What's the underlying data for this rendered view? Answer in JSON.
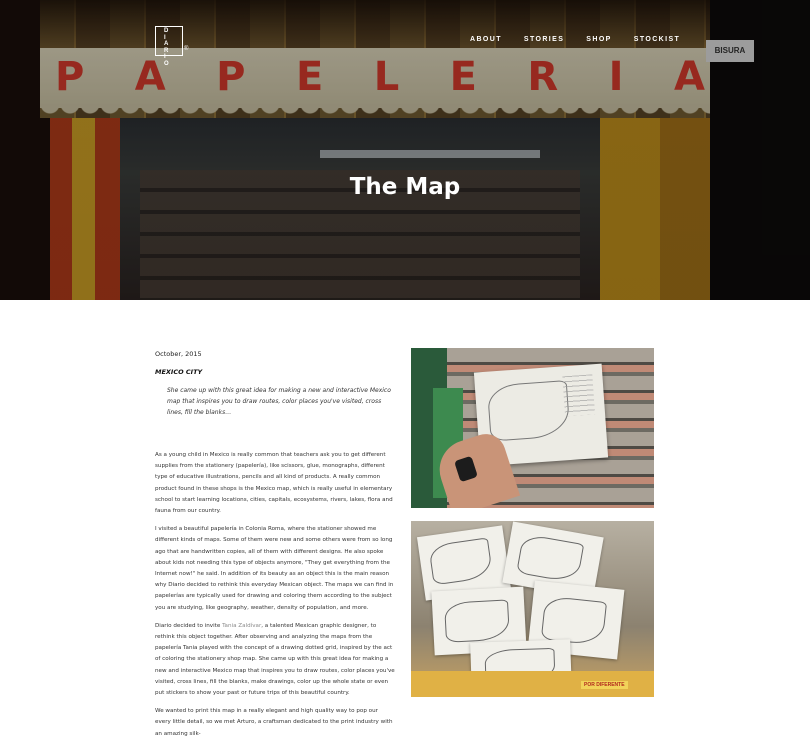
{
  "header": {
    "logo_letters": "D\nI\nA\nR\nI\nO",
    "logo_reg": "®",
    "nav": [
      "ABOUT",
      "STORIES",
      "SHOP",
      "STOCKIST"
    ],
    "hero_title": "The Map",
    "hero_sign": "PAPELERIA"
  },
  "article": {
    "date": "October, 2015",
    "location": "MEXICO CITY",
    "quote": "She came up with this great idea for making a new and interactive Mexico map that inspires you to draw routes, color places you've visited, cross lines, fill the blanks…",
    "p1": "As a young child in Mexico is really common that teachers ask you to get different supplies from the stationery (papelería), like scissors, glue, monographs, different type of educative illustrations, pencils and all kind of products. A really common product found in these shops is the Mexico map, which is really useful in elementary school to start learning locations, cities, capitals, ecosystems, rivers, lakes, flora and fauna from our country.",
    "p2": "I visited a beautiful papelería in Colonia Roma, where the stationer showed me different kinds of maps. Some of them were new and some others were from so long ago that are handwritten copies, all of them with different designs. He also spoke about kids not needing this type of objects anymore, \"They get everything from the Internet now!\" he said.  In addition of its beauty as an object this is the main reason why Diario decided to rethink this everyday Mexican object. The maps we can find in papelerías are typically used for drawing and coloring them according to the subject you are studying, like geography, weather, density of population, and more.",
    "p3_before_link": "Diario decided to invite ",
    "p3_link": "Tania Zaldívar",
    "p3_after_link": ", a talented Mexican graphic designer, to rethink this object together.  After observing and analyzing the maps from the papelería Tania played with the concept of a drawing dotted grid, inspired by the act of coloring the stationery shop map. She came up with this great idea for making a new and interactive Mexico map that inspires you to draw routes, color places you've visited, cross lines, fill the blanks, make drawings, color up the whole state or even put stickers to show your past or future trips of this beautiful country.",
    "p4": "We wanted to print this map in a really elegant and high quality way to pop our every little detail, so we met Arturo, a craftsman dedicated to the print industry with an amazing silk-"
  },
  "photos": {
    "p2_label": "POR DIFERENTE"
  }
}
